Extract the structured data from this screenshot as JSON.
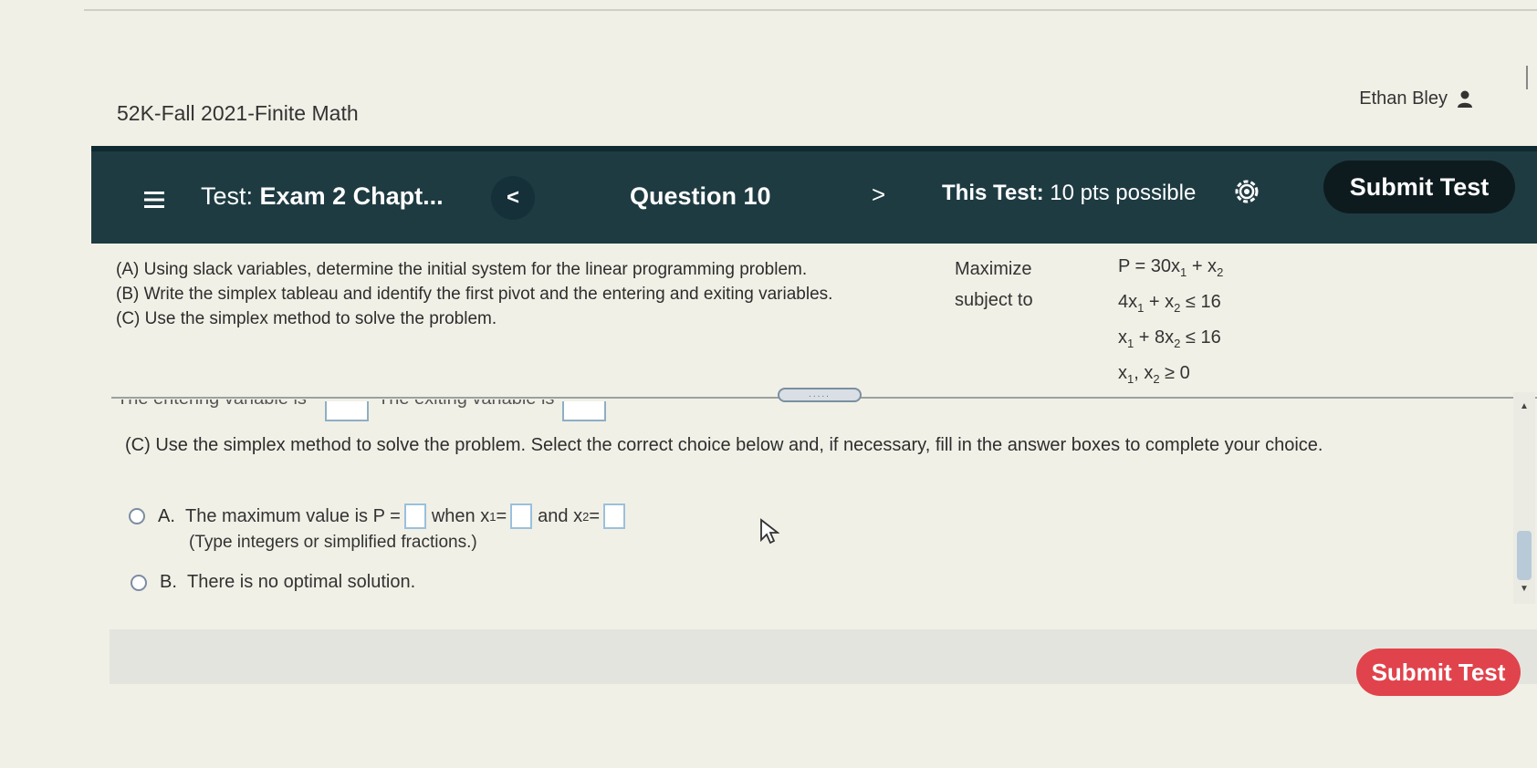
{
  "header": {
    "course_title": "52K-Fall 2021-Finite Math",
    "user_name": "Ethan Bley"
  },
  "nav": {
    "test_prefix": "Test: ",
    "test_name": "Exam 2 Chapt...",
    "prev_symbol": "<",
    "question_label": "Question 10",
    "next_symbol": ">",
    "pts_prefix": "This Test: ",
    "pts_value": "10 pts possible",
    "submit_label": "Submit Test"
  },
  "problem": {
    "instructions": [
      "(A) Using slack variables, determine the initial system for the linear programming problem.",
      "(B) Write the simplex tableau and identify the first pivot and the entering and exiting variables.",
      "(C) Use the simplex method to solve the problem."
    ],
    "maximize_label": "Maximize",
    "subject_to_label": "subject to",
    "objective": {
      "lhs": "P = 30x",
      "mid": " + x"
    },
    "constraint1": {
      "a": "4x",
      "b": " + x",
      "rhs": " ≤ 16"
    },
    "constraint2": {
      "a": "x",
      "b": " + 8x",
      "rhs": " ≤ 16"
    },
    "constraint3": {
      "a": "x",
      "b": ", x",
      "rhs": " ≥ 0"
    },
    "sub1": "1",
    "sub2": "2"
  },
  "cutoff": {
    "entering_text": "The entering variable is",
    "exiting_text": "The exiting variable is"
  },
  "section_c": {
    "prompt": "(C) Use the simplex method to solve the problem. Select the correct choice below and, if necessary, fill in the answer boxes to complete your choice.",
    "choice_a": {
      "letter": "A.",
      "text1": "The maximum value is P =",
      "text2": "when x",
      "text3": " =",
      "text4": "and x",
      "text5": " =",
      "hint": "(Type integers or simplified fractions.)"
    },
    "choice_b": {
      "letter": "B.",
      "text": "There is no optimal solution."
    }
  },
  "handle_label": ".....",
  "footer": {
    "submit_label": "Submit Test"
  },
  "colors": {
    "nav_bg": "#1e3b42",
    "submit_bottom": "#e0434c",
    "answer_box_border": "#9bc0dc"
  }
}
